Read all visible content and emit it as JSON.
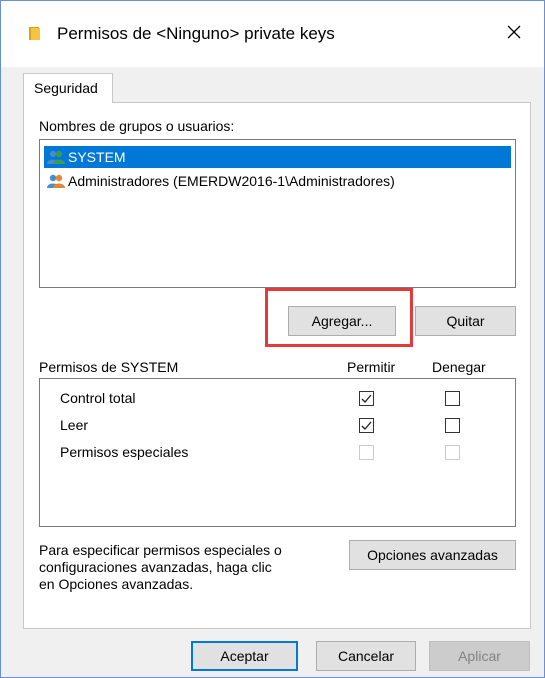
{
  "window": {
    "title": "Permisos de <Ninguno> private keys",
    "close_glyph": "✕"
  },
  "tabs": [
    {
      "label": "Seguridad",
      "active": true
    }
  ],
  "groups": {
    "label": "Nombres de grupos o usuarios:",
    "items": [
      {
        "name": "SYSTEM",
        "selected": true,
        "icon": "users-group-icon"
      },
      {
        "name": "Administradores (EMERDW2016-1\\Administradores)",
        "selected": false,
        "icon": "users-group-icon"
      }
    ],
    "add_label": "Agregar...",
    "remove_label": "Quitar"
  },
  "permissions": {
    "label": "Permisos de SYSTEM",
    "allow_header": "Permitir",
    "deny_header": "Denegar",
    "rows": [
      {
        "name": "Control total",
        "allow": true,
        "deny": false,
        "enabled": true
      },
      {
        "name": "Leer",
        "allow": true,
        "deny": false,
        "enabled": true
      },
      {
        "name": "Permisos especiales",
        "allow": false,
        "deny": false,
        "enabled": false
      }
    ]
  },
  "advanced": {
    "text_lines": [
      "Para especificar permisos especiales o",
      "configuraciones avanzadas, haga clic",
      "en Opciones avanzadas."
    ],
    "button_label": "Opciones avanzadas"
  },
  "footer": {
    "accept_label": "Aceptar",
    "cancel_label": "Cancelar",
    "apply_label": "Aplicar"
  },
  "colors": {
    "selection": "#0078d7",
    "highlight_border": "#e33b3b",
    "folder_icon": "#f4c542"
  }
}
